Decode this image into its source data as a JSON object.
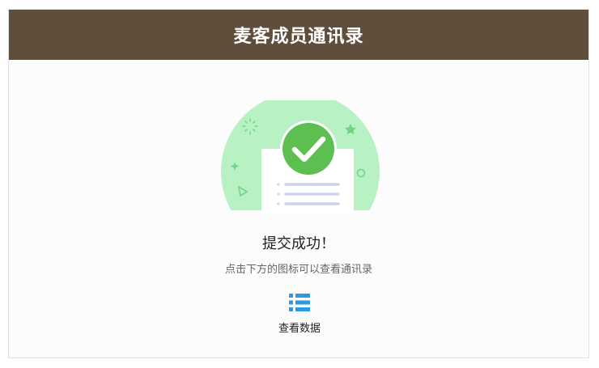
{
  "header": {
    "title": "麦客成员通讯录"
  },
  "result": {
    "title": "提交成功！",
    "subtitle": "点击下方的图标可以查看通讯录"
  },
  "actions": {
    "view_data_label": "查看数据",
    "view_data_icon": "list-icon"
  },
  "colors": {
    "header_bg": "#604e3d",
    "success_green": "#5cbf4f",
    "illustration_bg": "#b8f2c4",
    "icon_blue": "#2b9be0"
  }
}
